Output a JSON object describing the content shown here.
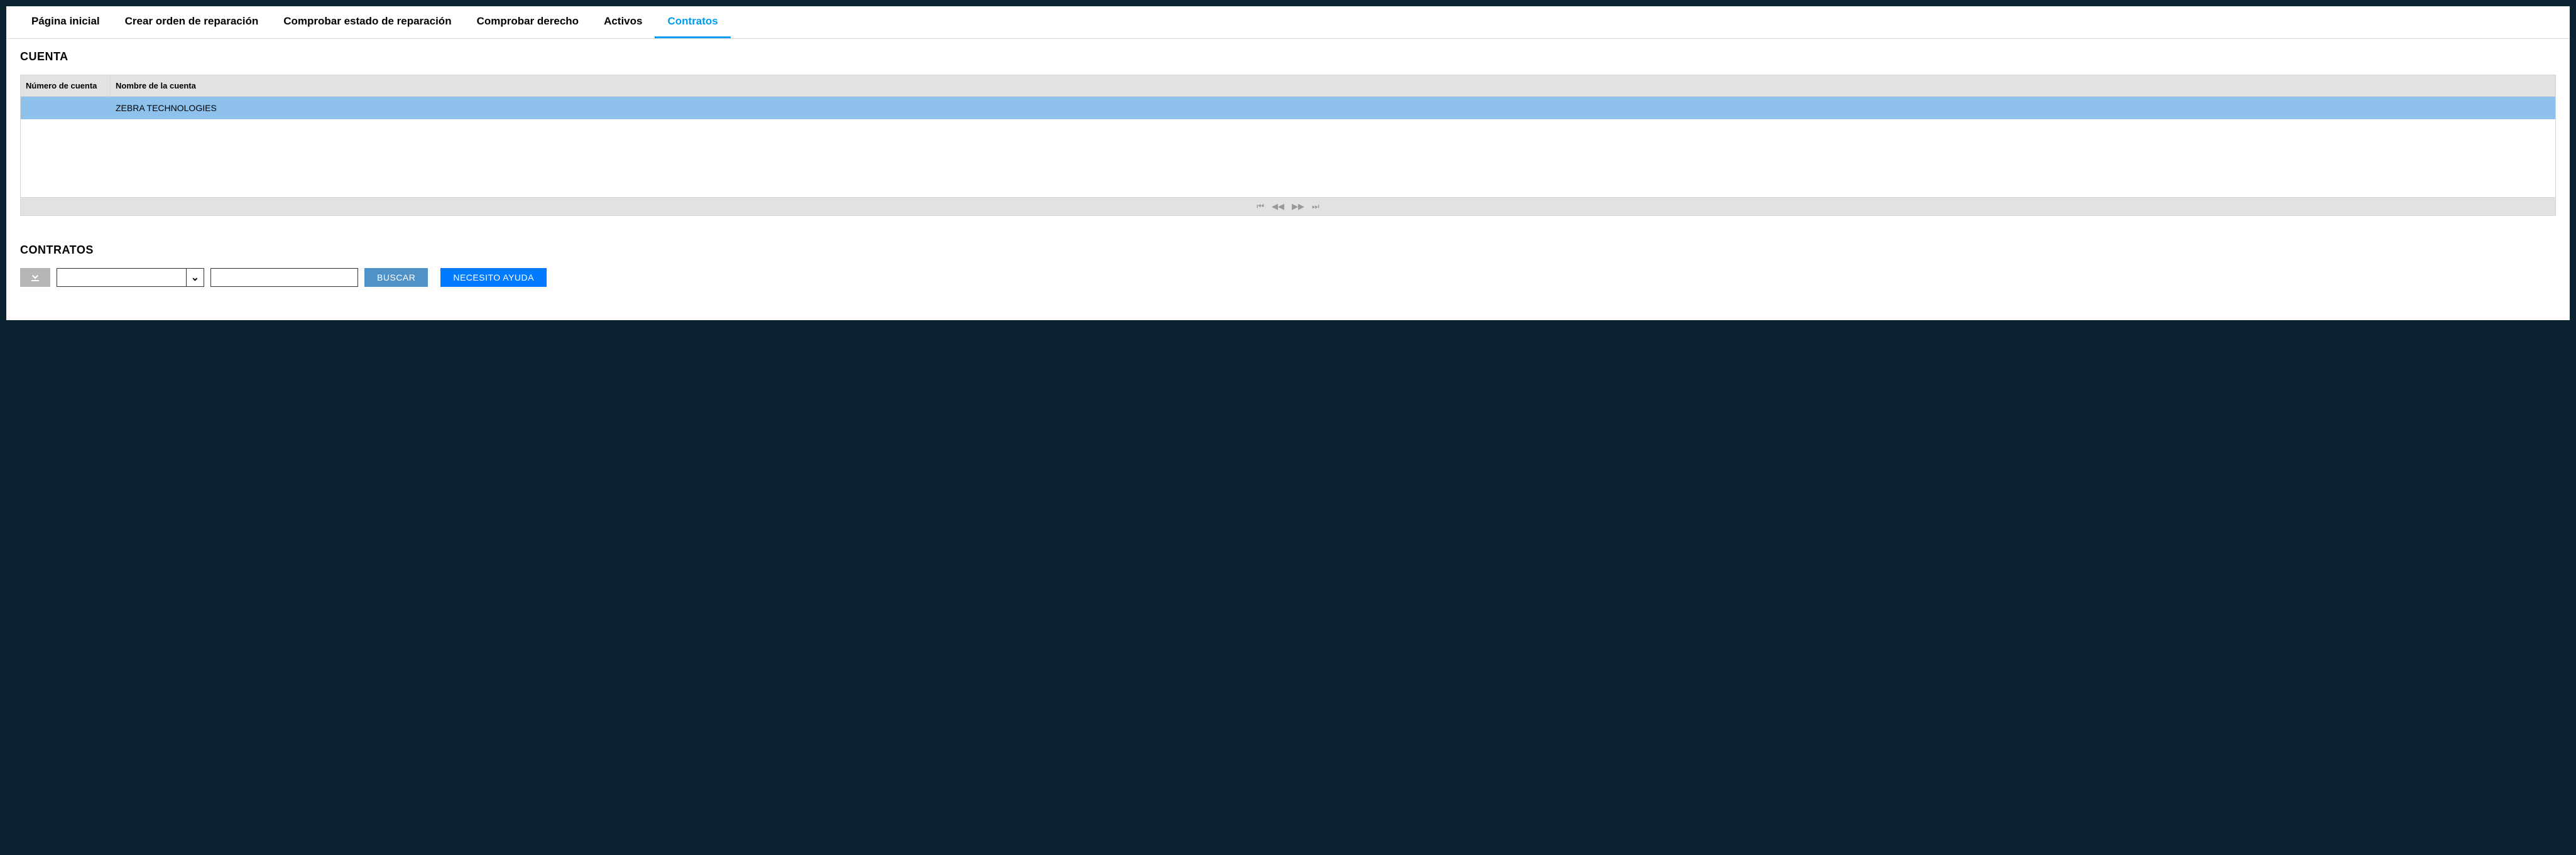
{
  "nav": {
    "tabs": [
      {
        "label": "Página inicial"
      },
      {
        "label": "Crear orden de reparación"
      },
      {
        "label": "Comprobar estado de reparación"
      },
      {
        "label": "Comprobar derecho"
      },
      {
        "label": "Activos"
      },
      {
        "label": "Contratos"
      }
    ],
    "active_index": 5
  },
  "sections": {
    "cuenta": {
      "heading": "CUENTA",
      "columns": {
        "account_number": "Número de cuenta",
        "account_name": "Nombre de la cuenta"
      },
      "rows": [
        {
          "account_number": "",
          "account_name": "ZEBRA TECHNOLOGIES"
        }
      ]
    },
    "contratos": {
      "heading": "CONTRATOS",
      "toolbar": {
        "filter_select_value": "",
        "filter_input_value": "",
        "search_label": "BUSCAR",
        "help_label": "NECESITO AYUDA"
      }
    }
  }
}
